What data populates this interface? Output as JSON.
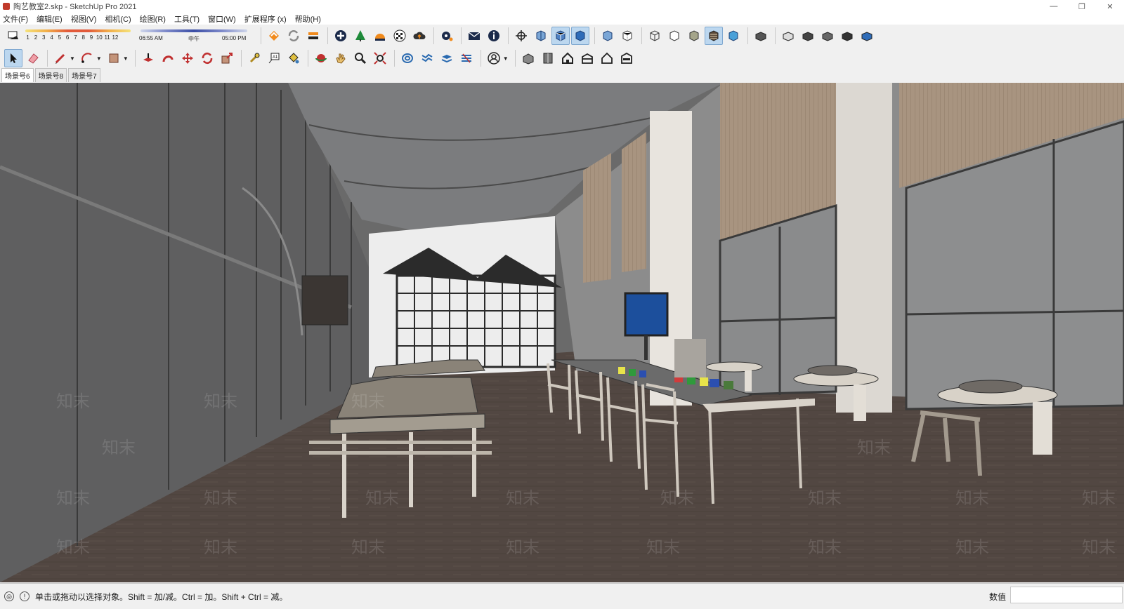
{
  "window": {
    "title": "陶艺教室2.skp - SketchUp Pro 2021",
    "minimize": "—",
    "restore": "❐",
    "close": "✕"
  },
  "menus": [
    "文件(F)",
    "编辑(E)",
    "视图(V)",
    "相机(C)",
    "绘图(R)",
    "工具(T)",
    "窗口(W)",
    "扩展程序 (x)",
    "帮助(H)"
  ],
  "shadow": {
    "months": [
      "1",
      "2",
      "3",
      "4",
      "5",
      "6",
      "7",
      "8",
      "9",
      "10",
      "11",
      "12"
    ],
    "time_start": "06:55 AM",
    "time_mid": "中午",
    "time_end": "05:00 PM"
  },
  "scenes": [
    {
      "label": "场景号6",
      "active": true
    },
    {
      "label": "场景号8",
      "active": false
    },
    {
      "label": "场景号7",
      "active": false
    }
  ],
  "viewport": {
    "watermark": "知末"
  },
  "status": {
    "hint": "单击或拖动以选择对象。Shift = 加/减。Ctrl = 加。Shift + Ctrl = 减。",
    "measurements_label": "数值",
    "measurements_value": ""
  },
  "colors": {
    "ceiling": "#7b7c7e",
    "floor": "#524742",
    "wall": "#676768",
    "blinds": "#a89480",
    "active_tool": "#bcd7ef"
  }
}
